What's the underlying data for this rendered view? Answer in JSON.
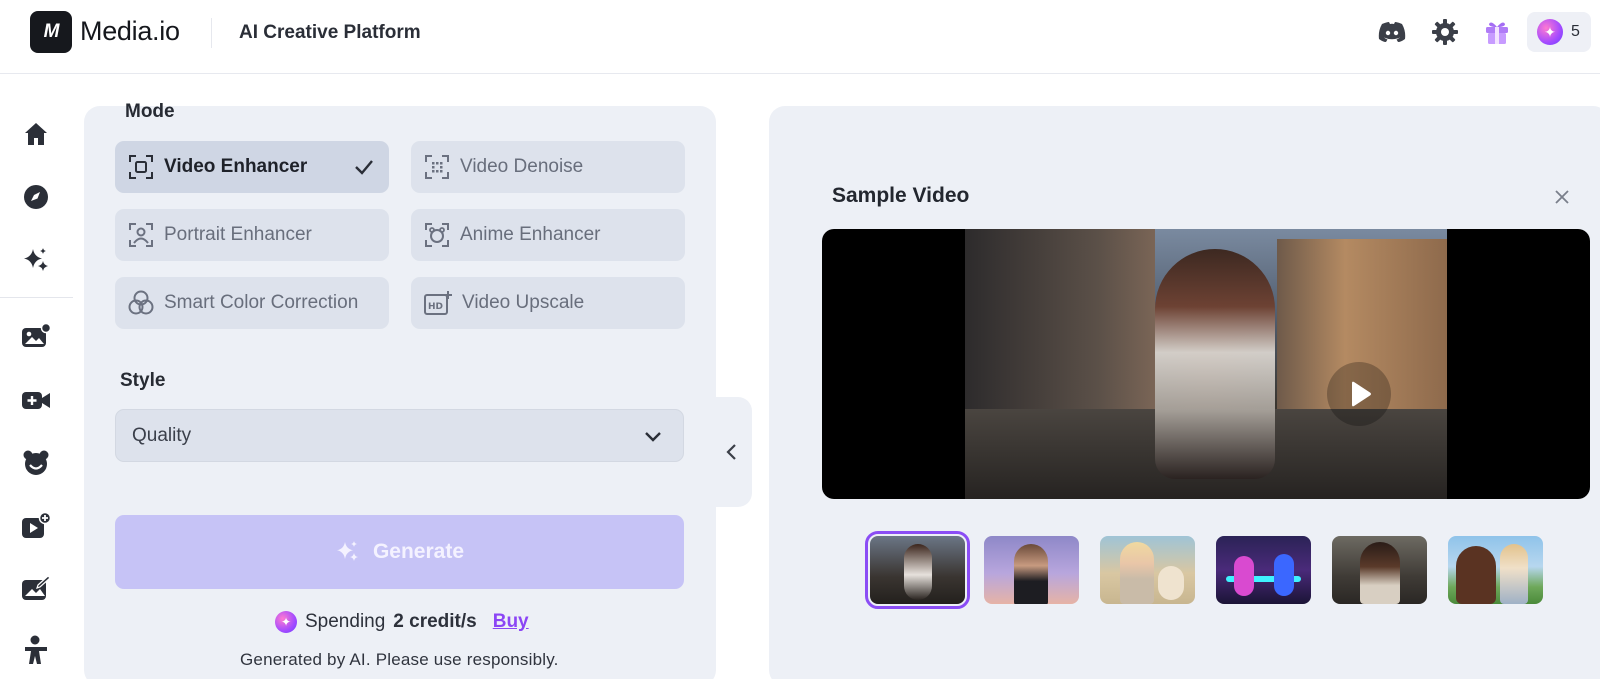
{
  "header": {
    "logo_mark": "M",
    "app_name": "Media.io",
    "platform_title": "AI Creative Platform",
    "credits_count": "5",
    "icons": [
      "discord-icon",
      "gear-icon",
      "gift-icon",
      "credit-icon"
    ]
  },
  "nav": {
    "items": [
      "home-icon",
      "explore-icon",
      "sparkles-icon",
      "image-tools-icon",
      "video-tools-icon",
      "avatar-icon",
      "add-video-icon",
      "photo-edit-icon",
      "character-icon"
    ]
  },
  "settings": {
    "mode_label": "Mode",
    "modes": [
      {
        "label": "Video Enhancer",
        "icon": "scan-icon",
        "active": true
      },
      {
        "label": "Video Denoise",
        "icon": "denoise-icon",
        "active": false
      },
      {
        "label": "Portrait Enhancer",
        "icon": "portrait-icon",
        "active": false
      },
      {
        "label": "Anime Enhancer",
        "icon": "anime-icon",
        "active": false
      },
      {
        "label": "Smart Color Correction",
        "icon": "color-icon",
        "active": false
      },
      {
        "label": "Video Upscale",
        "icon": "hd-icon",
        "active": false
      }
    ],
    "style_label": "Style",
    "style_value": "Quality",
    "generate_label": "Generate",
    "spending_prefix": "Spending",
    "spending_amount": "2 credit/s",
    "buy_label": "Buy",
    "disclaimer": "Generated by AI. Please use responsibly."
  },
  "preview": {
    "title": "Sample Video",
    "selected_thumb": 0,
    "thumb_count": 6
  },
  "colors": {
    "accent": "#8b4df5",
    "panel_bg": "#edf0f6",
    "generate_disabled": "#c6c3f6"
  }
}
